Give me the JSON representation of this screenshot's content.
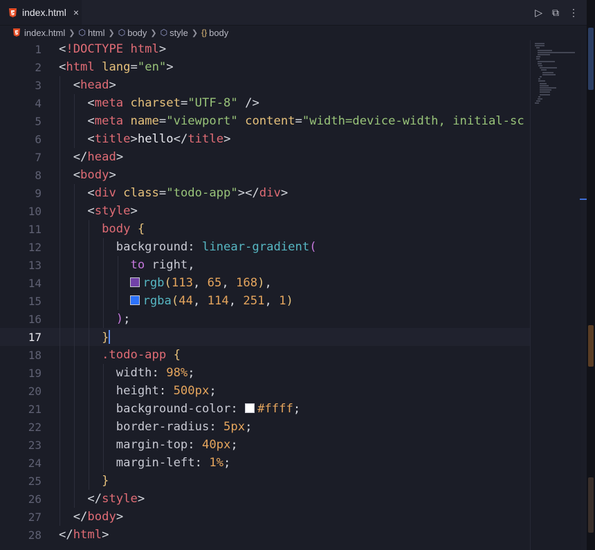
{
  "tab": {
    "filename": "index.html",
    "file_icon": "html5-icon",
    "close_icon": "×"
  },
  "actions": {
    "run_icon": "▷",
    "split_icon": "⧉",
    "more_icon": "⋮"
  },
  "breadcrumb": [
    {
      "label": "index.html",
      "icon": "html5-icon"
    },
    {
      "label": "html",
      "icon": "cube-icon"
    },
    {
      "label": "body",
      "icon": "cube-icon"
    },
    {
      "label": "style",
      "icon": "cube-icon"
    },
    {
      "label": "body",
      "icon": "bracket-icon"
    }
  ],
  "editor": {
    "active_line": 17,
    "line_numbers": [
      "1",
      "2",
      "3",
      "4",
      "5",
      "6",
      "7",
      "8",
      "9",
      "10",
      "11",
      "12",
      "13",
      "14",
      "15",
      "16",
      "17",
      "18",
      "19",
      "20",
      "21",
      "22",
      "23",
      "24",
      "25",
      "26",
      "27",
      "28"
    ],
    "lines": [
      [
        [
          "t-punc",
          "<"
        ],
        [
          "t-tag",
          "!DOCTYPE html"
        ],
        [
          "t-punc",
          ">"
        ]
      ],
      [
        [
          "t-punc",
          "<"
        ],
        [
          "t-tag",
          "html"
        ],
        [
          "t-attr",
          " lang"
        ],
        [
          "t-punc",
          "="
        ],
        [
          "t-str",
          "\"en\""
        ],
        [
          "t-punc",
          ">"
        ]
      ],
      [
        [
          "t-punc",
          "  <"
        ],
        [
          "t-tag",
          "head"
        ],
        [
          "t-punc",
          ">"
        ]
      ],
      [
        [
          "t-punc",
          "    <"
        ],
        [
          "t-tag",
          "meta"
        ],
        [
          "t-attr",
          " charset"
        ],
        [
          "t-punc",
          "="
        ],
        [
          "t-str",
          "\"UTF-8\""
        ],
        [
          "t-punc",
          " />"
        ]
      ],
      [
        [
          "t-punc",
          "    <"
        ],
        [
          "t-tag",
          "meta"
        ],
        [
          "t-attr",
          " name"
        ],
        [
          "t-punc",
          "="
        ],
        [
          "t-str",
          "\"viewport\""
        ],
        [
          "t-attr",
          " content"
        ],
        [
          "t-punc",
          "="
        ],
        [
          "t-str",
          "\"width=device-width, initial-sc"
        ]
      ],
      [
        [
          "t-punc",
          "    <"
        ],
        [
          "t-tag",
          "title"
        ],
        [
          "t-punc",
          ">"
        ],
        [
          "t-text",
          "hello"
        ],
        [
          "t-punc",
          "</"
        ],
        [
          "t-tag",
          "title"
        ],
        [
          "t-punc",
          ">"
        ]
      ],
      [
        [
          "t-punc",
          "  </"
        ],
        [
          "t-tag",
          "head"
        ],
        [
          "t-punc",
          ">"
        ]
      ],
      [
        [
          "t-punc",
          "  <"
        ],
        [
          "t-tag",
          "body"
        ],
        [
          "t-punc",
          ">"
        ]
      ],
      [
        [
          "t-punc",
          "    <"
        ],
        [
          "t-tag",
          "div"
        ],
        [
          "t-attr",
          " class"
        ],
        [
          "t-punc",
          "="
        ],
        [
          "t-str",
          "\"todo-app\""
        ],
        [
          "t-punc",
          "></"
        ],
        [
          "t-tag",
          "div"
        ],
        [
          "t-punc",
          ">"
        ]
      ],
      [
        [
          "t-punc",
          "    <"
        ],
        [
          "t-tag",
          "style"
        ],
        [
          "t-punc",
          ">"
        ]
      ],
      [
        [
          "t-sel",
          "      body "
        ],
        [
          "t-brace",
          "{"
        ]
      ],
      [
        [
          "t-prop",
          "        background"
        ],
        [
          "t-punc",
          ": "
        ],
        [
          "t-fn",
          "linear-gradient"
        ],
        [
          "t-brace2",
          "("
        ]
      ],
      [
        [
          "t-kw",
          "          to"
        ],
        [
          "t-prop",
          " right"
        ],
        [
          "t-punc",
          ","
        ]
      ],
      [
        [
          "t-punc",
          "          "
        ],
        [
          "swatch",
          "#7141a8"
        ],
        [
          "t-fn",
          "rgb"
        ],
        [
          "t-brace",
          "("
        ],
        [
          "t-num",
          "113"
        ],
        [
          "t-punc",
          ", "
        ],
        [
          "t-num",
          "65"
        ],
        [
          "t-punc",
          ", "
        ],
        [
          "t-num",
          "168"
        ],
        [
          "t-brace",
          ")"
        ],
        [
          "t-punc",
          ","
        ]
      ],
      [
        [
          "t-punc",
          "          "
        ],
        [
          "swatch",
          "#2c72fb"
        ],
        [
          "t-fn",
          "rgba"
        ],
        [
          "t-brace",
          "("
        ],
        [
          "t-num",
          "44"
        ],
        [
          "t-punc",
          ", "
        ],
        [
          "t-num",
          "114"
        ],
        [
          "t-punc",
          ", "
        ],
        [
          "t-num",
          "251"
        ],
        [
          "t-punc",
          ", "
        ],
        [
          "t-num",
          "1"
        ],
        [
          "t-brace",
          ")"
        ]
      ],
      [
        [
          "t-brace2",
          "        )"
        ],
        [
          "t-punc",
          ";"
        ]
      ],
      [
        [
          "t-brace",
          "      }"
        ],
        [
          "cursor",
          ""
        ]
      ],
      [
        [
          "t-sel",
          "      .todo-app "
        ],
        [
          "t-brace",
          "{"
        ]
      ],
      [
        [
          "t-prop",
          "        width"
        ],
        [
          "t-punc",
          ": "
        ],
        [
          "t-num",
          "98%"
        ],
        [
          "t-punc",
          ";"
        ]
      ],
      [
        [
          "t-prop",
          "        height"
        ],
        [
          "t-punc",
          ": "
        ],
        [
          "t-num",
          "500px"
        ],
        [
          "t-punc",
          ";"
        ]
      ],
      [
        [
          "t-prop",
          "        background-color"
        ],
        [
          "t-punc",
          ": "
        ],
        [
          "swatch",
          "#ffffff"
        ],
        [
          "t-num",
          "#ffff"
        ],
        [
          "t-punc",
          ";"
        ]
      ],
      [
        [
          "t-prop",
          "        border-radius"
        ],
        [
          "t-punc",
          ": "
        ],
        [
          "t-num",
          "5px"
        ],
        [
          "t-punc",
          ";"
        ]
      ],
      [
        [
          "t-prop",
          "        margin-top"
        ],
        [
          "t-punc",
          ": "
        ],
        [
          "t-num",
          "40px"
        ],
        [
          "t-punc",
          ";"
        ]
      ],
      [
        [
          "t-prop",
          "        margin-left"
        ],
        [
          "t-punc",
          ": "
        ],
        [
          "t-num",
          "1%"
        ],
        [
          "t-punc",
          ";"
        ]
      ],
      [
        [
          "t-brace",
          "      }"
        ]
      ],
      [
        [
          "t-punc",
          "    </"
        ],
        [
          "t-tag",
          "style"
        ],
        [
          "t-punc",
          ">"
        ]
      ],
      [
        [
          "t-punc",
          "  </"
        ],
        [
          "t-tag",
          "body"
        ],
        [
          "t-punc",
          ">"
        ]
      ],
      [
        [
          "t-punc",
          "</"
        ],
        [
          "t-tag",
          "html"
        ],
        [
          "t-punc",
          ">"
        ]
      ]
    ]
  },
  "colors": {
    "accent": "#3f6fd8",
    "background": "#1b1d27"
  }
}
